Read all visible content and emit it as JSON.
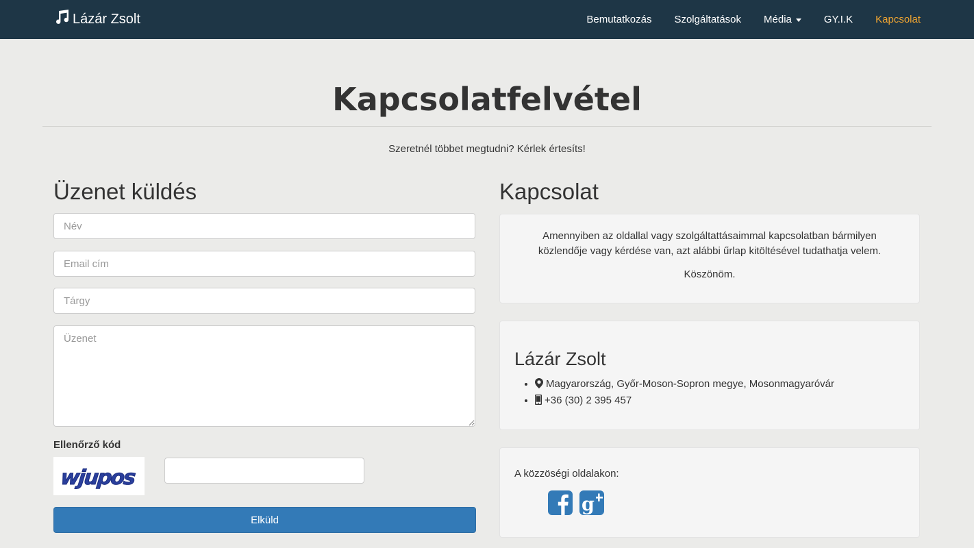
{
  "navbar": {
    "brand": "Lázár Zsolt",
    "items": [
      {
        "label": "Bemutatkozás"
      },
      {
        "label": "Szolgáltatások"
      },
      {
        "label": "Média"
      },
      {
        "label": "GY.I.K"
      },
      {
        "label": "Kapcsolat"
      }
    ],
    "active_color": "#f0a531"
  },
  "header": {
    "title": "Kapcsolatfelvétel",
    "subtitle": "Szeretnél többet megtudni? Kérlek értesíts!"
  },
  "form": {
    "heading": "Üzenet küldés",
    "name_placeholder": "Név",
    "email_placeholder": "Email cím",
    "subject_placeholder": "Tárgy",
    "message_placeholder": "Üzenet",
    "captcha_label": "Ellenőrző kód",
    "captcha_text": "wjupos",
    "submit_label": "Elküld"
  },
  "contact": {
    "heading": "Kapcsolat",
    "intro": "Amennyiben az oldallal vagy szolgáltattásaimmal kapcsolatban bármilyen közlendője vagy kérdése van, azt alábbi űrlap kitöltésével tudathatja velem.",
    "thanks": "Köszönöm.",
    "person_name": "Lázár Zsolt",
    "address": "Magyarország, Győr-Moson-Sopron megye, Mosonmagyaróvár",
    "phone": "+36 (30) 2 395 457",
    "social_label": "A közzöségi oldalakon:"
  },
  "colors": {
    "navbar_bg": "#1e3646",
    "primary_button": "#337ab7",
    "social_icon": "#337ab7"
  }
}
